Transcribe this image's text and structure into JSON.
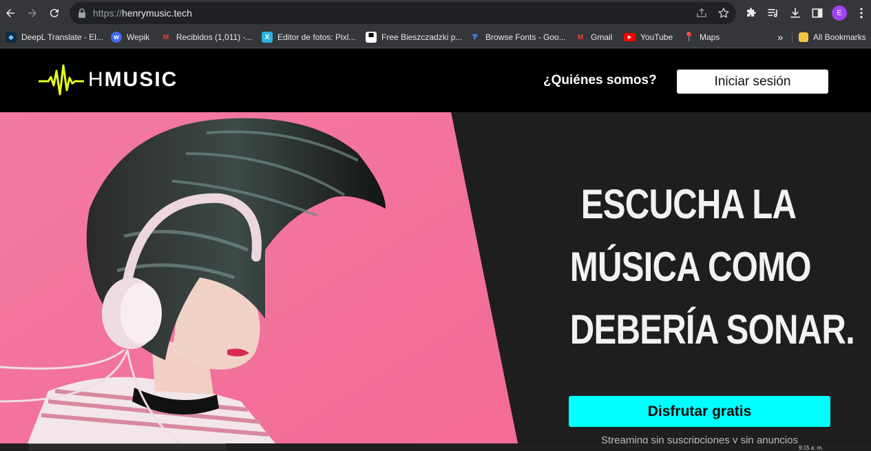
{
  "browser": {
    "url_scheme": "https://",
    "url_host": "henrymusic.tech",
    "profile_initial": "E",
    "bookmarks": [
      {
        "label": "DeepL Translate - El...",
        "icon": "deepl-icon",
        "color": "#0f2b46"
      },
      {
        "label": "Wepik",
        "icon": "wepik-icon",
        "color": "#3c6cf0"
      },
      {
        "label": "Recibidos (1,011) -...",
        "icon": "gmail-icon",
        "color": "#ea4335"
      },
      {
        "label": "Editor de fotos: Pixl...",
        "icon": "pixlr-icon",
        "color": "#2bb3e0"
      },
      {
        "label": "Free Bieszczadzki p...",
        "icon": "free-icon",
        "color": "#ffffff"
      },
      {
        "label": "Browse Fonts - Goo...",
        "icon": "google-fonts-icon",
        "color": "#4285f4"
      },
      {
        "label": "Gmail",
        "icon": "gmail-icon",
        "color": "#ea4335"
      },
      {
        "label": "YouTube",
        "icon": "youtube-icon",
        "color": "#ff0000"
      },
      {
        "label": "Maps",
        "icon": "maps-icon",
        "color": "#34a853"
      }
    ],
    "overflow_label": "»",
    "all_bookmarks_label": "All Bookmarks"
  },
  "site": {
    "logo_h": "H",
    "logo_rest": "MUSIC",
    "nav_about": "¿Quiénes somos?",
    "login_label": "Iniciar sesión"
  },
  "hero": {
    "title_line1": "ESCUCHA LA",
    "title_line2": "MÚSICA COMO",
    "title_line3": "DEBERÍA SONAR.",
    "cta_label": "Disfrutar gratis",
    "cta_sub": "Streaming sin suscripciones y sin anuncios"
  },
  "taskbar": {
    "clock": "9:15 a. m."
  },
  "colors": {
    "accent": "#00ffff",
    "logo_wave": "#e6ff1a",
    "hero_bg": "#1e1e1e",
    "photo_bg": "#f47ba0"
  }
}
